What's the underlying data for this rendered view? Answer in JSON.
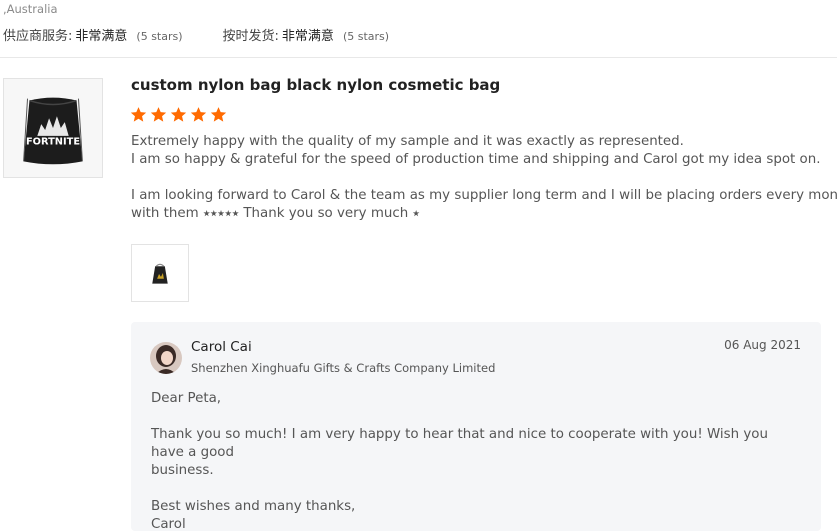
{
  "buyer": {
    "location": ",Australia"
  },
  "ratings": [
    {
      "label": "供应商服务:",
      "value": "非常满意",
      "stars": "(5 stars)"
    },
    {
      "label": "按时发货:",
      "value": "非常满意",
      "stars": "(5 stars)"
    }
  ],
  "review": {
    "product_title": "custom nylon bag black nylon cosmetic bag",
    "star_rating": 5,
    "star_color": "#ff6a00",
    "text_line_1": "Extremely happy with the quality of my sample and it was exactly as represented.",
    "text_line_2": "I am so happy & grateful for the speed of production time and shipping and Carol got my idea spot on.",
    "text_line_3": "I am looking forward to Carol & the team as my supplier long term and I will be placing orders every month",
    "text_line_4": "with them ⭑⭑⭑⭑⭑ Thank you so very much ⭑",
    "product_image_text": "FORTNITE"
  },
  "reply": {
    "name": "Carol Cai",
    "company": "Shenzhen Xinghuafu Gifts & Crafts Company Limited",
    "date": "06 Aug 2021",
    "greeting": "Dear Peta,",
    "paragraph": "Thank you so much! I am very happy to hear that and nice to cooperate with you! Wish you have a good\nbusiness.",
    "closing": "Best wishes and many thanks,\nCarol"
  },
  "icons": {
    "rating_star": "star-icon",
    "product_image": "drawstring-bag-image",
    "attachment_image": "drawstring-bag-thumbnail",
    "avatar": "user-avatar"
  }
}
